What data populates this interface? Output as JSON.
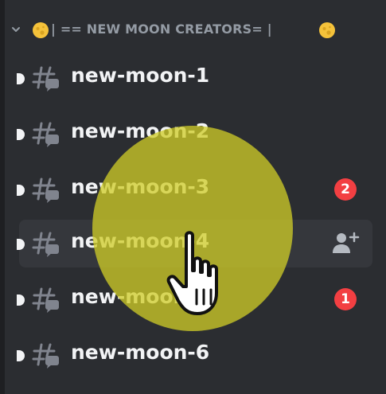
{
  "category": {
    "label": "| == NEW MOON CREATORS= |",
    "left_icon": "moon-emoji-icon",
    "right_icon": "moon-emoji-icon",
    "collapse_icon": "chevron-down-icon"
  },
  "channels": [
    {
      "name": "new-moon-1",
      "unread": true,
      "badge": ""
    },
    {
      "name": "new-moon-2",
      "unread": true,
      "badge": ""
    },
    {
      "name": "new-moon-3",
      "unread": true,
      "badge": "2"
    },
    {
      "name": "new-moon-4",
      "unread": true,
      "badge": "",
      "active": true,
      "action_icon": "add-user-icon"
    },
    {
      "name": "new-moon-5",
      "unread": true,
      "badge": "1"
    },
    {
      "name": "new-moon-6",
      "unread": true,
      "badge": ""
    }
  ],
  "overlay": {
    "highlight_color": "#d0cd28",
    "cursor_icon": "hand-pointer-icon"
  },
  "colors": {
    "background": "#2b2d31",
    "active_row": "#35373c",
    "mention_badge": "#f23f42",
    "text": "#f2f3f5",
    "muted": "#949ba4"
  }
}
